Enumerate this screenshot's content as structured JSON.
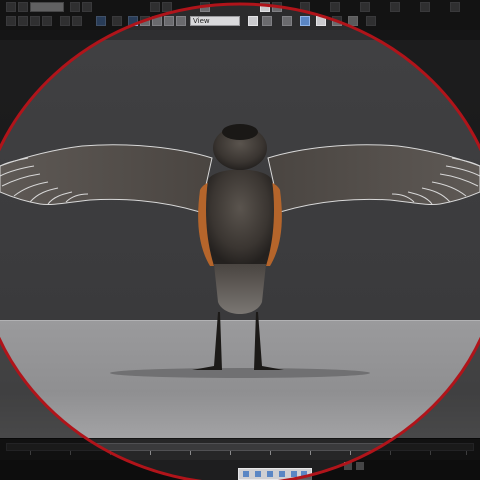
{
  "toolbar": {
    "selection_set_placeholder": "",
    "view_dropdown_value": "View"
  },
  "viewport": {
    "label": ""
  },
  "colors": {
    "ring": "#b0141a",
    "wireframe": "#d8d8d8",
    "bird_body": "#3a3531",
    "bird_breast": "#b5652b"
  },
  "icons": {
    "undo": "undo-icon",
    "redo": "redo-icon",
    "select": "select-object-icon",
    "move": "move-icon",
    "rotate": "rotate-icon",
    "scale": "scale-icon",
    "snap": "snap-icon",
    "mirror": "mirror-icon",
    "align": "align-icon",
    "render": "render-icon",
    "material": "material-editor-icon",
    "play": "play-icon",
    "next-frame": "next-frame-icon",
    "prev-frame": "prev-frame-icon"
  }
}
